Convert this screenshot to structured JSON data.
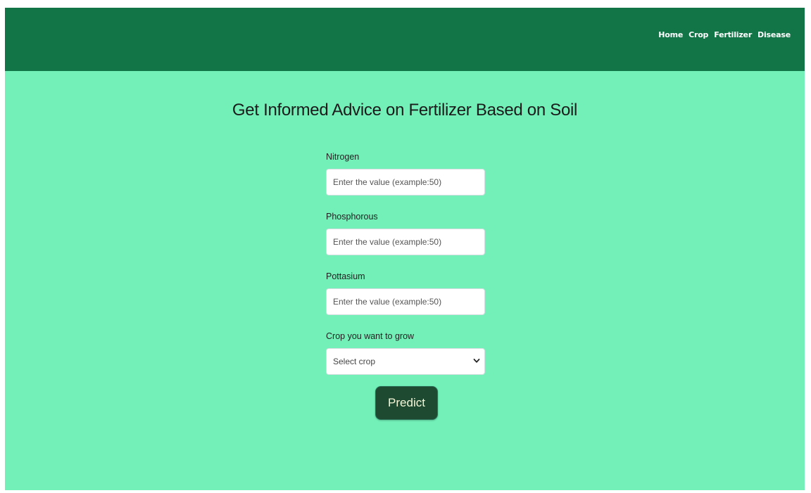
{
  "nav": {
    "links": [
      "Home",
      "Crop",
      "Fertilizer",
      "Disease"
    ]
  },
  "page": {
    "title": "Get Informed Advice on Fertilizer Based on Soil"
  },
  "form": {
    "nitrogen": {
      "label": "Nitrogen",
      "placeholder": "Enter the value (example:50)",
      "value": ""
    },
    "phosphorous": {
      "label": "Phosphorous",
      "placeholder": "Enter the value (example:50)",
      "value": ""
    },
    "pottasium": {
      "label": "Pottasium",
      "placeholder": "Enter the value (example:50)",
      "value": ""
    },
    "crop": {
      "label": "Crop you want to grow",
      "selected": "Select crop",
      "icon": "chevron-down-icon"
    },
    "submit_label": "Predict"
  },
  "colors": {
    "navbar": "#117547",
    "background": "#72f0b8",
    "button": "#1d4a30"
  }
}
